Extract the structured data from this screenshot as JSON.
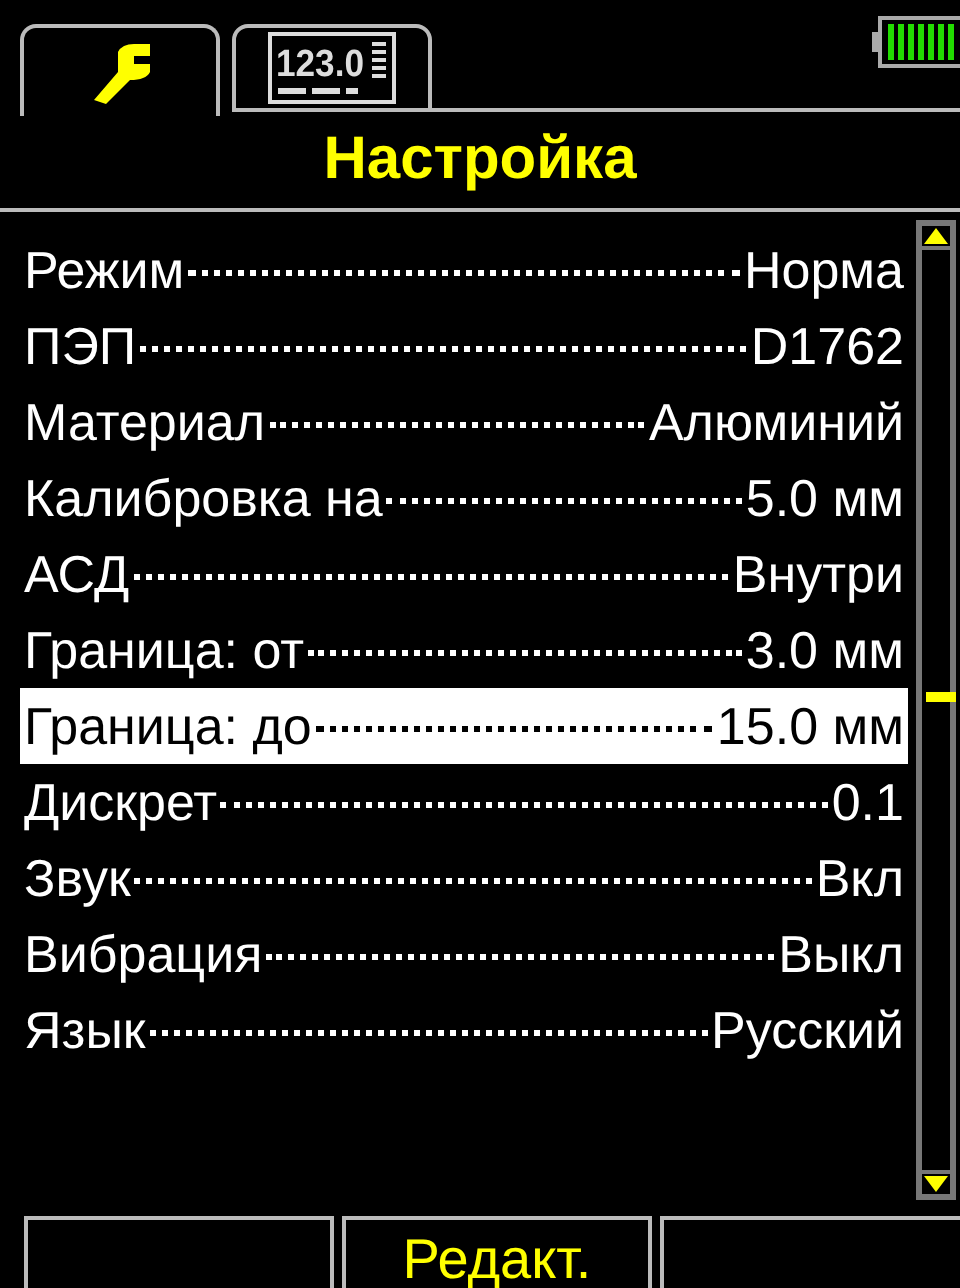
{
  "tabs": [
    {
      "kind": "wrench",
      "selected": true
    },
    {
      "kind": "readout",
      "readout": "123.0",
      "selected": false
    }
  ],
  "title": "Настройка",
  "settings": [
    {
      "label": "Режим",
      "value": "Норма",
      "selected": false
    },
    {
      "label": "ПЭП",
      "value": "D1762",
      "selected": false
    },
    {
      "label": "Материал",
      "value": "Алюминий",
      "selected": false
    },
    {
      "label": "Калибровка на",
      "value": "5.0 мм",
      "selected": false
    },
    {
      "label": "АСД",
      "value": "Внутри",
      "selected": false
    },
    {
      "label": "Граница: от",
      "value": "3.0 мм",
      "selected": false
    },
    {
      "label": "Граница: до",
      "value": "15.0 мм",
      "selected": true
    },
    {
      "label": "Дискрет",
      "value": "0.1",
      "selected": false
    },
    {
      "label": "Звук",
      "value": "Вкл",
      "selected": false
    },
    {
      "label": "Вибрация",
      "value": "Выкл",
      "selected": false
    },
    {
      "label": "Язык",
      "value": "Русский",
      "selected": false
    }
  ],
  "softkeys": [
    {
      "kind": "blank"
    },
    {
      "kind": "text",
      "label": "Редакт."
    },
    {
      "kind": "blank"
    }
  ]
}
